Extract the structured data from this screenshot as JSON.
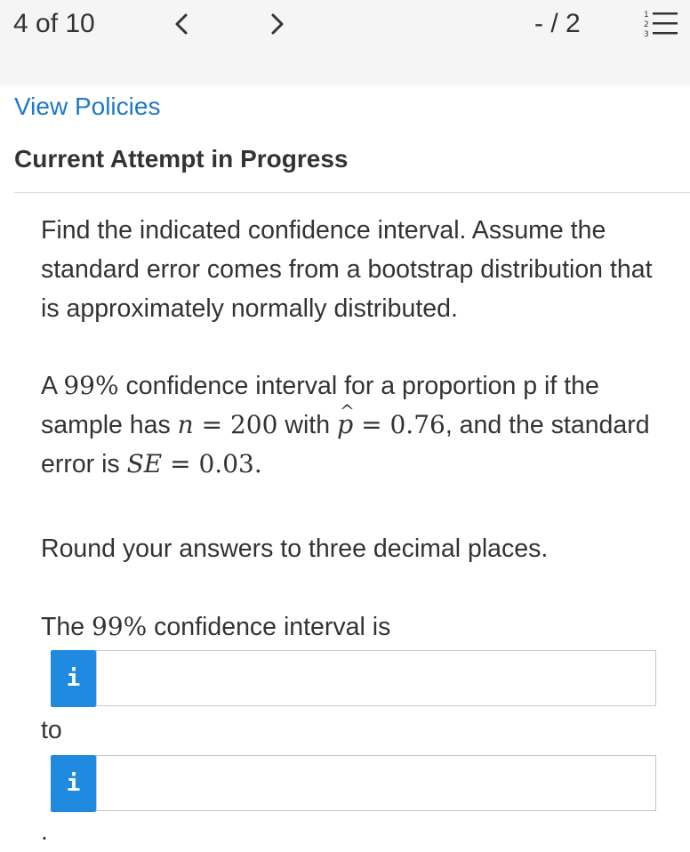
{
  "header": {
    "counter": "4 of 10",
    "prev_icon": "chevron-left-icon",
    "next_icon": "chevron-right-icon",
    "score": "- / 2",
    "list_icon": "numbered-list-icon"
  },
  "links": {
    "view_policies": "View Policies"
  },
  "attempt": {
    "title": "Current Attempt in Progress"
  },
  "question": {
    "intro": "Find the indicated confidence interval. Assume the standard error comes from a bootstrap distribution that is approximately normally distributed.",
    "p2_a": "A",
    "p2_level": "99%",
    "p2_b": " confidence interval for a proportion p if the sample has ",
    "p2_n": "n",
    "p2_n_eq": " = 200",
    "p2_with": " with ",
    "p2_p": "p",
    "p2_p_eq": " = 0.76",
    "p2_c": ", and the standard error is ",
    "p2_se": "SE",
    "p2_se_eq": " = 0.03",
    "p2_end": ".",
    "round": "Round your answers to three decimal places.",
    "ci_a": "The ",
    "ci_level": "99%",
    "ci_b": " confidence interval is",
    "to": "to",
    "end": "."
  },
  "inputs": {
    "lower": {
      "value": "",
      "info_icon": "i"
    },
    "upper": {
      "value": "",
      "info_icon": "i"
    }
  },
  "colors": {
    "link": "#1f79c7",
    "info_button": "#1f8ae0",
    "topbar": "#f5f5f5"
  }
}
